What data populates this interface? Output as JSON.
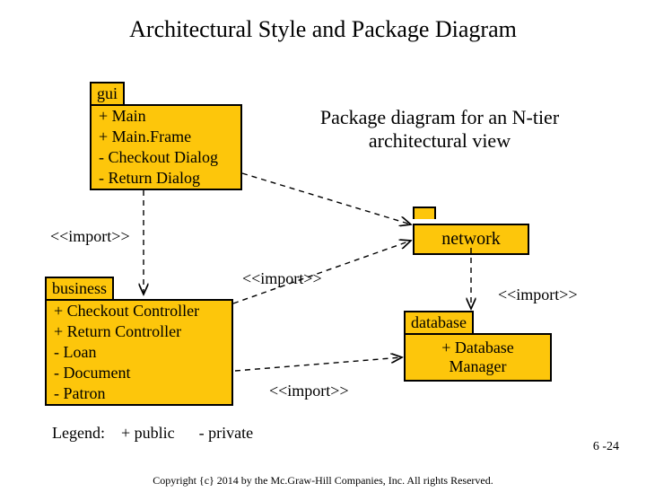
{
  "title": "Architectural Style and Package Diagram",
  "caption_line1": "Package diagram for an N-tier",
  "caption_line2": "architectural view",
  "packages": {
    "gui": {
      "tab": "gui",
      "items": [
        "+ Main",
        "+ Main.Frame",
        "- Checkout Dialog",
        "- Return Dialog"
      ]
    },
    "business": {
      "tab": "business",
      "items": [
        "+ Checkout Controller",
        "+ Return Controller",
        "- Loan",
        "- Document",
        "- Patron"
      ]
    },
    "network": {
      "tab": "",
      "label": "network"
    },
    "database": {
      "tab": "database",
      "items": [
        "+ Database",
        "   Manager"
      ]
    }
  },
  "stereotypes": {
    "s1": "<<import>>",
    "s2": "<<import>>",
    "s3": "<<import>>",
    "s4": "<<import>>"
  },
  "legend": {
    "label": "Legend:",
    "public": "+ public",
    "private": "- private"
  },
  "slide_number": "6 -24",
  "copyright": "Copyright {c} 2014 by the Mc.Graw-Hill Companies, Inc. All rights Reserved."
}
